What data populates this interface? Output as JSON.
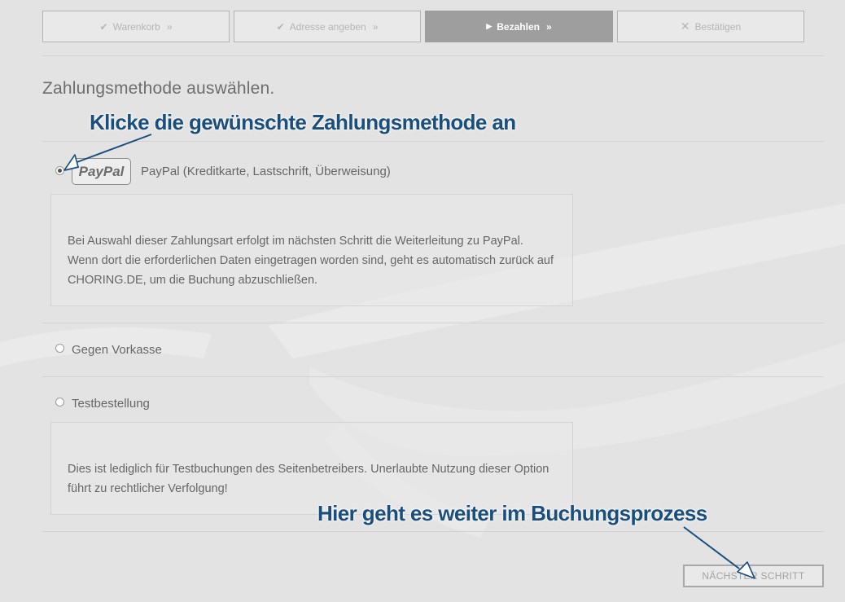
{
  "steps": [
    {
      "label": "Warenkorb",
      "mark": "✔",
      "chevron": "»",
      "icon": "checkmark-icon",
      "state": "done"
    },
    {
      "label": "Adresse angeben",
      "mark": "✔",
      "chevron": "»",
      "icon": "checkmark-icon",
      "state": "done"
    },
    {
      "label": "Bezahlen",
      "mark": "▶",
      "chevron": "»",
      "icon": "play-icon",
      "state": "active"
    },
    {
      "label": "Bestätigen",
      "mark": "✕",
      "chevron": "",
      "icon": "cross-icon",
      "state": "pending"
    }
  ],
  "page": {
    "heading": "Zahlungsmethode auswählen."
  },
  "annotations": {
    "top": "Klicke die gewünschte Zahlungsmethode an",
    "bottom": "Hier geht es weiter im Buchungsprozess"
  },
  "payment_methods": [
    {
      "logo": "PayPal",
      "label": "PayPal (Kreditkarte, Lastschrift, Überweisung)",
      "selected": true,
      "description": "Bei Auswahl dieser Zahlungsart erfolgt im nächsten Schritt die Weiterleitung zu PayPal. Wenn dort die erforderlichen Daten eingetragen worden sind, geht es automatisch zurück auf CHORING.DE, um die Buchung abzuschließen."
    },
    {
      "label": "Gegen Vorkasse",
      "selected": false
    },
    {
      "label": "Testbestellung",
      "selected": false,
      "description": "Dies ist lediglich für Testbuchungen des Seitenbetreibers. Unerlaubte Nutzung dieser Option führt zu rechtlicher Verfolgung!"
    }
  ],
  "next_button": {
    "label": "NÄCHSTER SCHRITT"
  },
  "colors": {
    "annotation": "#1a4f7d",
    "active_step": "#9e9e9e",
    "background": "#e3e3e3"
  }
}
